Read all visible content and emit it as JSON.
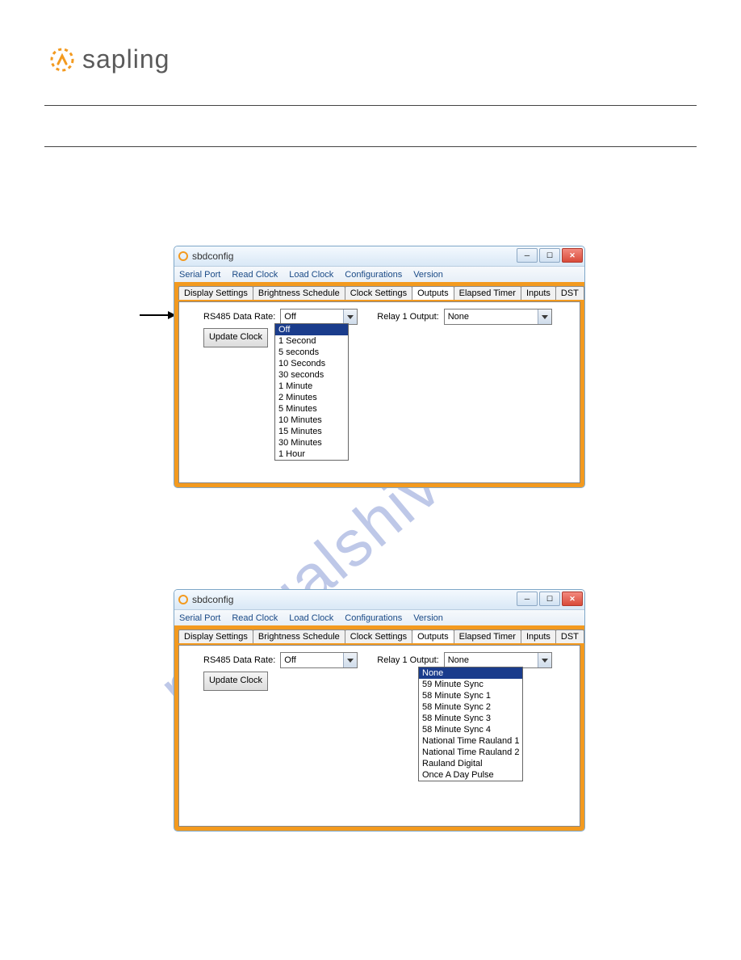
{
  "logo": {
    "text": "sapling"
  },
  "watermark": "manualshive.com",
  "window": {
    "title": "sbdconfig",
    "menu": [
      "Serial Port",
      "Read Clock",
      "Load Clock",
      "Configurations",
      "Version"
    ],
    "tabs": [
      "Display Settings",
      "Brightness Schedule",
      "Clock Settings",
      "Outputs",
      "Elapsed Timer",
      "Inputs",
      "DST"
    ],
    "active_tab": "Outputs",
    "labels": {
      "rs485": "RS485 Data Rate:",
      "relay1": "Relay 1 Output:",
      "update": "Update Clock"
    },
    "rs485_value": "Off",
    "relay1_value": "None",
    "rs485_options": [
      "Off",
      "1 Second",
      "5 seconds",
      "10 Seconds",
      "30 seconds",
      "1 Minute",
      "2 Minutes",
      "5 Minutes",
      "10 Minutes",
      "15 Minutes",
      "30 Minutes",
      "1 Hour"
    ],
    "relay1_options": [
      "None",
      "59 Minute Sync",
      "58 Minute Sync 1",
      "58 Minute Sync 2",
      "58 Minute Sync 3",
      "58 Minute Sync 4",
      "National Time Rauland 1",
      "National Time Rauland 2",
      "Rauland Digital",
      "Once A Day Pulse"
    ]
  }
}
